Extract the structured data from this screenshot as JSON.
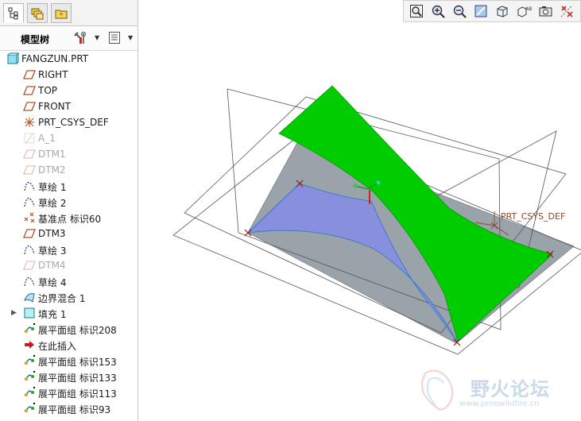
{
  "sidebar": {
    "tree_title": "模型树",
    "tabs": [
      {
        "icon": "model-tree-tab-icon",
        "active": true
      },
      {
        "icon": "layers-tab-icon",
        "active": false
      },
      {
        "icon": "folder-star-tab-icon",
        "active": false
      }
    ],
    "tools": [
      {
        "icon": "settings-tools-icon"
      },
      {
        "icon": "show-list-icon"
      }
    ],
    "items": [
      {
        "label": "FANGZUN.PRT",
        "icon": "part-icon",
        "dim": false,
        "indent": 0
      },
      {
        "label": "RIGHT",
        "icon": "datum-plane-icon",
        "dim": false,
        "indent": 1
      },
      {
        "label": "TOP",
        "icon": "datum-plane-icon",
        "dim": false,
        "indent": 1
      },
      {
        "label": "FRONT",
        "icon": "datum-plane-icon",
        "dim": false,
        "indent": 1
      },
      {
        "label": "PRT_CSYS_DEF",
        "icon": "coordinate-system-icon",
        "dim": false,
        "indent": 1
      },
      {
        "label": "A_1",
        "icon": "datum-axis-icon",
        "dim": true,
        "indent": 1
      },
      {
        "label": "DTM1",
        "icon": "datum-plane-icon",
        "dim": true,
        "indent": 1
      },
      {
        "label": "DTM2",
        "icon": "datum-plane-icon",
        "dim": true,
        "indent": 1
      },
      {
        "label": "草绘 1",
        "icon": "sketch-icon",
        "dim": false,
        "indent": 1
      },
      {
        "label": "草绘 2",
        "icon": "sketch-icon",
        "dim": false,
        "indent": 1
      },
      {
        "label": "基准点 标识60",
        "icon": "datum-point-icon",
        "dim": false,
        "indent": 1
      },
      {
        "label": "DTM3",
        "icon": "datum-plane-icon",
        "dim": false,
        "indent": 1
      },
      {
        "label": "草绘 3",
        "icon": "sketch-icon",
        "dim": false,
        "indent": 1
      },
      {
        "label": "DTM4",
        "icon": "datum-plane-icon",
        "dim": true,
        "indent": 1
      },
      {
        "label": "草绘 4",
        "icon": "sketch-icon",
        "dim": false,
        "indent": 1
      },
      {
        "label": "边界混合 1",
        "icon": "boundary-blend-icon",
        "dim": false,
        "indent": 1
      },
      {
        "label": "填充 1",
        "icon": "fill-icon",
        "dim": false,
        "indent": 1,
        "expandable": true
      },
      {
        "label": "展平面组 标识208",
        "icon": "flatten-quilt-icon",
        "dim": false,
        "indent": 1
      },
      {
        "label": "在此插入",
        "icon": "insert-here-arrow-icon",
        "dim": false,
        "indent": 1
      },
      {
        "label": "展平面组 标识153",
        "icon": "flatten-quilt-icon",
        "dim": false,
        "indent": 1
      },
      {
        "label": "展平面组 标识133",
        "icon": "flatten-quilt-icon",
        "dim": false,
        "indent": 1
      },
      {
        "label": "展平面组 标识113",
        "icon": "flatten-quilt-icon",
        "dim": false,
        "indent": 1
      },
      {
        "label": "展平面组 标识93",
        "icon": "flatten-quilt-icon",
        "dim": false,
        "indent": 1
      }
    ]
  },
  "toolbar": {
    "buttons": [
      {
        "icon": "refit-icon"
      },
      {
        "icon": "zoom-in-icon"
      },
      {
        "icon": "zoom-out-icon"
      },
      {
        "icon": "repaint-icon"
      },
      {
        "icon": "display-style-icon"
      },
      {
        "icon": "saved-views-icon"
      },
      {
        "icon": "view-manager-icon"
      },
      {
        "icon": "datum-display-icon"
      }
    ]
  },
  "viewport": {
    "csys_label": "PRT_CSYS_DEF",
    "colors": {
      "green_surface": "#00cc00",
      "blue_surface": "#8890dd",
      "gray_surface": "#9aa2aa",
      "datum_lines": "#555555",
      "point_marker": "#a01010"
    }
  },
  "watermark": {
    "text": "野火论坛",
    "url": "www.proewildfire.cn"
  }
}
